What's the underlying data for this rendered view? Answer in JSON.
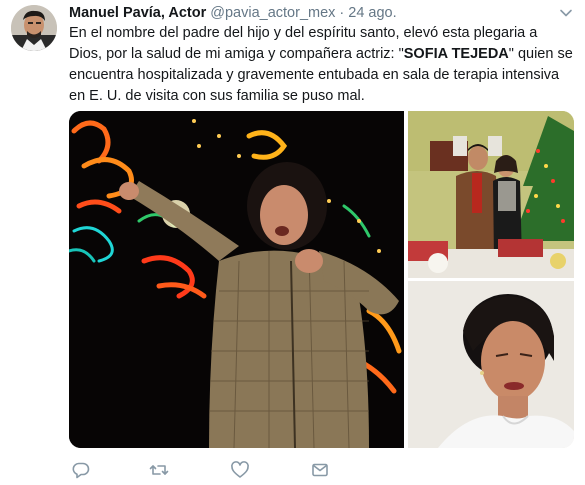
{
  "tweet": {
    "author_name": "Manuel Pavía, Actor",
    "handle": "@pavia_actor_mex",
    "separator": "·",
    "timestamp": "24 ago.",
    "text_before": "En el nombre del padre del hijo y del espíritu santo, elevó esta plegaria a Dios, por la salud de mi amiga y compañera actriz: \"",
    "text_highlight": "SOFIA TEJEDA",
    "text_after": "\" quien se encuentra hospitalizada y gravemente entubada en sala de terapia intensiva en E. U. de visita con sus familia se puso mal."
  },
  "icons": {
    "menu": "chevron-down-icon",
    "reply": "reply-icon",
    "retweet": "retweet-icon",
    "like": "heart-icon",
    "message": "envelope-icon"
  },
  "colors": {
    "text": "#14171a",
    "secondary": "#657786",
    "icon": "#8899a6"
  }
}
